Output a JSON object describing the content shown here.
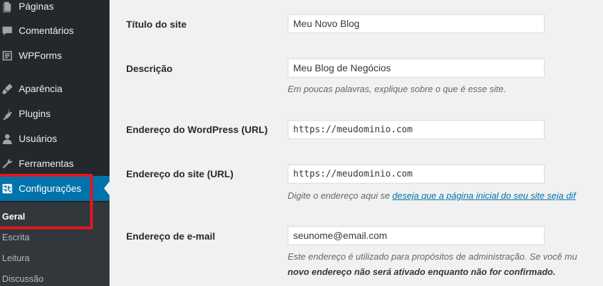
{
  "sidebar": {
    "items": [
      {
        "label": "Páginas",
        "icon": "pages-icon"
      },
      {
        "label": "Comentários",
        "icon": "comments-icon"
      },
      {
        "label": "WPForms",
        "icon": "wpforms-icon"
      },
      {
        "label": "Aparência",
        "icon": "appearance-icon"
      },
      {
        "label": "Plugins",
        "icon": "plugins-icon"
      },
      {
        "label": "Usuários",
        "icon": "users-icon"
      },
      {
        "label": "Ferramentas",
        "icon": "tools-icon"
      },
      {
        "label": "Configurações",
        "icon": "settings-icon"
      }
    ],
    "submenu": [
      "Geral",
      "Escrita",
      "Leitura",
      "Discussão"
    ],
    "colors": {
      "background": "#23282d",
      "active": "#0073aa",
      "highlight": "#e8141e"
    }
  },
  "form": {
    "site_title": {
      "label": "Título do site",
      "value": "Meu Novo Blog"
    },
    "tagline": {
      "label": "Descrição",
      "value": "Meu Blog de Negócios",
      "description": "Em poucas palavras, explique sobre o que é esse site."
    },
    "wp_address": {
      "label": "Endereço do WordPress (URL)",
      "value": "https://meudominio.com"
    },
    "site_address": {
      "label": "Endereço do site (URL)",
      "value": "https://meudominio.com",
      "description_prefix": "Digite o endereço aqui se ",
      "description_link": "deseja que a página inicial do seu site seja dif"
    },
    "email": {
      "label": "Endereço de e-mail",
      "value": "seunome@email.com",
      "description_line1": "Este endereço é utilizado para propósitos de administração. Se você mu",
      "description_line2": "novo endereço não será ativado enquanto não for confirmado."
    }
  }
}
